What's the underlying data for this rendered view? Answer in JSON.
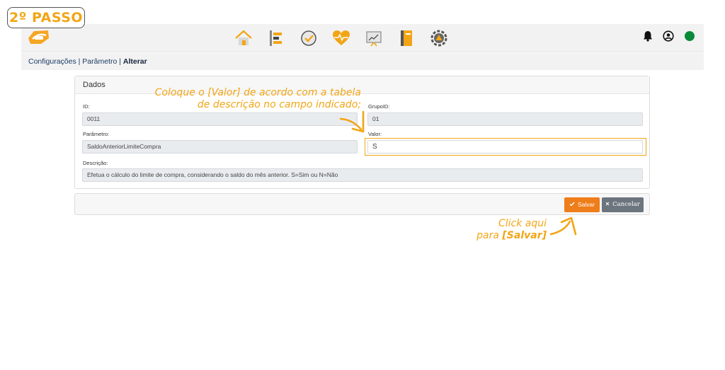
{
  "step_badge": "2º PASSO",
  "topbar": {
    "logo_icon": "app-logo-icon",
    "nav_icons": [
      "home-icon",
      "structure-icon",
      "check-clock-icon",
      "heart-pulse-icon",
      "chart-board-icon",
      "notebook-icon",
      "gear-triangle-icon"
    ],
    "right_icons": [
      "bell-icon",
      "user-circle-icon",
      "status-dot-icon"
    ],
    "status_color": "#0b8a3a"
  },
  "breadcrumb": {
    "items": [
      "Configurações",
      "Parâmetro"
    ],
    "separator": " | ",
    "current": "Alterar"
  },
  "form": {
    "title": "Dados",
    "id_label": "ID:",
    "id_value": "0011",
    "grupo_label": "GrupoID:",
    "grupo_value": "01",
    "parametro_label": "Parâmetro:",
    "parametro_value": "SaldoAnteriorLimiteCompra",
    "valor_label": "Valor:",
    "valor_value": "S",
    "descricao_label": "Descrição:",
    "descricao_value": "Efetua o cálculo do limite de compra, considerando o saldo do mês anterior. S=Sim ou N=Não"
  },
  "actions": {
    "save_label": "Salvar",
    "cancel_label": "Cancelar",
    "save_color": "#ef7d1a",
    "cancel_color": "#6c757d"
  },
  "annotations": {
    "instruction_line1": "Coloque o [Valor] de acordo com a tabela",
    "instruction_line2": "de descrição no campo indicado;",
    "click_line1": "Click aqui",
    "click_line2_prefix": "para ",
    "click_line2_bold": "[Salvar]",
    "accent_color": "#f2a515"
  }
}
